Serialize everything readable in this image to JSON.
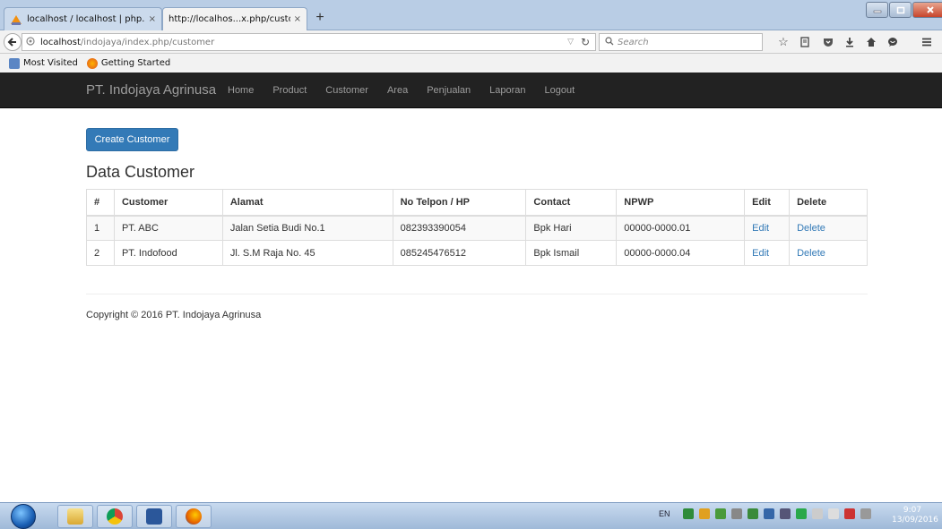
{
  "browser": {
    "tabs": [
      {
        "title": "localhost / localhost | php...",
        "close": "×"
      },
      {
        "title": "http://localhos...x.php/customer",
        "close": "×"
      }
    ],
    "new_tab": "+",
    "url_host": "localhost",
    "url_path": "/indojaya/index.php/customer",
    "search_placeholder": "Search",
    "bookmarks": [
      "Most Visited",
      "Getting Started"
    ]
  },
  "site": {
    "brand": "PT. Indojaya Agrinusa",
    "menu": [
      "Home",
      "Product",
      "Customer",
      "Area",
      "Penjualan",
      "Laporan",
      "Logout"
    ]
  },
  "main": {
    "create_button": "Create Customer",
    "title": "Data Customer",
    "table": {
      "headers": [
        "#",
        "Customer",
        "Alamat",
        "No Telpon / HP",
        "Contact",
        "NPWP",
        "Edit",
        "Delete"
      ],
      "rows": [
        [
          "1",
          "PT. ABC",
          "Jalan Setia Budi No.1",
          "082393390054",
          "Bpk Hari",
          "00000-0000.01",
          "Edit",
          "Delete"
        ],
        [
          "2",
          "PT. Indofood",
          "Jl. S.M Raja No. 45",
          "085245476512",
          "Bpk Ismail",
          "00000-0000.04",
          "Edit",
          "Delete"
        ]
      ]
    },
    "footer": "Copyright © 2016 PT. Indojaya Agrinusa"
  },
  "taskbar": {
    "language": "EN",
    "time": "9:07",
    "date": "13/09/2016"
  }
}
